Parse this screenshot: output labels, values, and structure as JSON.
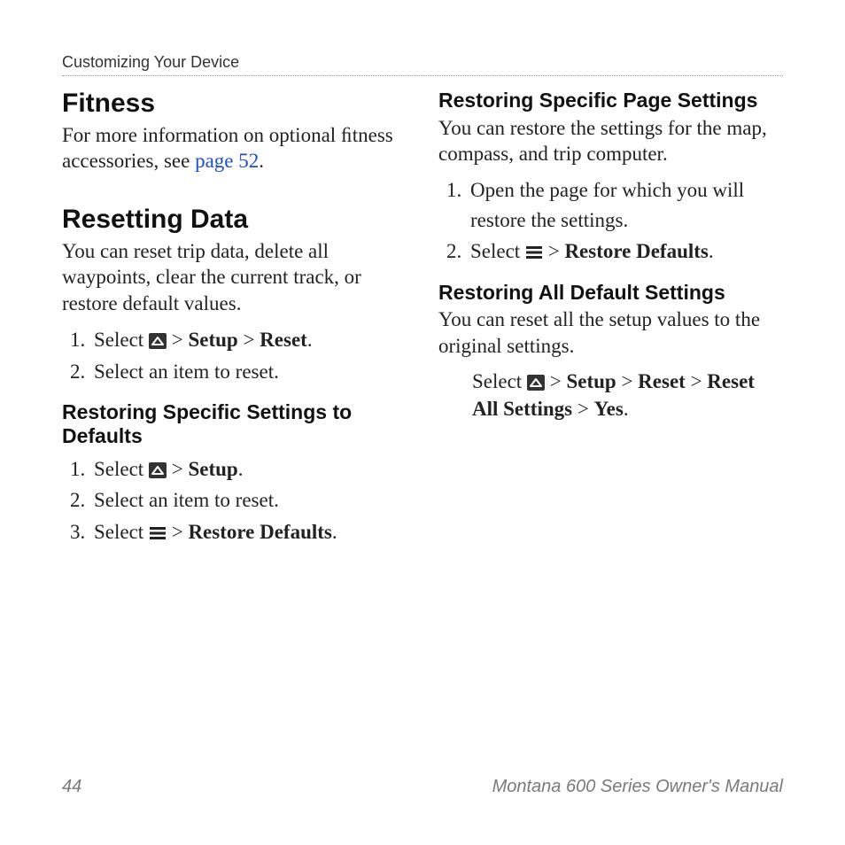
{
  "runningHead": "Customizing Your Device",
  "left": {
    "h_fitness": "Fitness",
    "p_fitness_a": "For more information on optional ﬁtness accessories, see ",
    "link_page52": "page 52",
    "p_fitness_b": ".",
    "h_reset": "Resetting Data",
    "p_reset": "You can reset trip data, delete all waypoints, clear the current track, or restore default values.",
    "step1_a": "Select ",
    "step1_b": " > ",
    "step1_setup": "Setup",
    "step1_c": " > ",
    "step1_reset": "Reset",
    "step1_d": ".",
    "step2": "Select an item to reset.",
    "h_restoreSpecific": "Restoring Speciﬁc Settings to Defaults",
    "rs_step1_a": "Select ",
    "rs_step1_b": " > ",
    "rs_step1_setup": "Setup",
    "rs_step1_c": ".",
    "rs_step2": "Select an item to reset.",
    "rs_step3_a": "Select ",
    "rs_step3_b": " > ",
    "rs_step3_restore": "Restore Defaults",
    "rs_step3_c": "."
  },
  "right": {
    "h_restorePage": "Restoring Speciﬁc Page Settings",
    "p_restorePage": "You can restore the settings for the map, compass, and trip computer.",
    "rp_step1": "Open the page for which you will restore the settings.",
    "rp_step2_a": "Select ",
    "rp_step2_b": " > ",
    "rp_step2_restore": "Restore Defaults",
    "rp_step2_c": ".",
    "h_restoreAll": "Restoring All Default Settings",
    "p_restoreAll": "You can reset all the setup values to the original settings.",
    "ra_a": "Select ",
    "ra_b": " > ",
    "ra_setup": "Setup",
    "ra_c": " > ",
    "ra_reset": "Reset",
    "ra_d": " > ",
    "ra_resetAll": "Reset All Settings",
    "ra_e": " > ",
    "ra_yes": "Yes",
    "ra_f": "."
  },
  "footer": {
    "pageNum": "44",
    "manual": "Montana 600 Series Owner's Manual"
  }
}
